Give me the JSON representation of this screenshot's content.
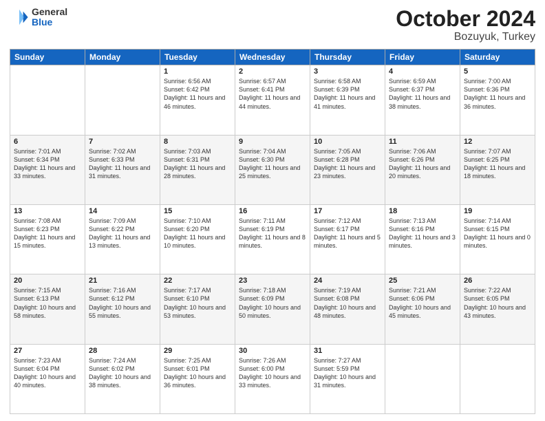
{
  "header": {
    "logo_general": "General",
    "logo_blue": "Blue",
    "title": "October 2024",
    "location": "Bozuyuk, Turkey"
  },
  "weekdays": [
    "Sunday",
    "Monday",
    "Tuesday",
    "Wednesday",
    "Thursday",
    "Friday",
    "Saturday"
  ],
  "weeks": [
    [
      {
        "day": "",
        "info": ""
      },
      {
        "day": "",
        "info": ""
      },
      {
        "day": "1",
        "info": "Sunrise: 6:56 AM\nSunset: 6:42 PM\nDaylight: 11 hours and 46 minutes."
      },
      {
        "day": "2",
        "info": "Sunrise: 6:57 AM\nSunset: 6:41 PM\nDaylight: 11 hours and 44 minutes."
      },
      {
        "day": "3",
        "info": "Sunrise: 6:58 AM\nSunset: 6:39 PM\nDaylight: 11 hours and 41 minutes."
      },
      {
        "day": "4",
        "info": "Sunrise: 6:59 AM\nSunset: 6:37 PM\nDaylight: 11 hours and 38 minutes."
      },
      {
        "day": "5",
        "info": "Sunrise: 7:00 AM\nSunset: 6:36 PM\nDaylight: 11 hours and 36 minutes."
      }
    ],
    [
      {
        "day": "6",
        "info": "Sunrise: 7:01 AM\nSunset: 6:34 PM\nDaylight: 11 hours and 33 minutes."
      },
      {
        "day": "7",
        "info": "Sunrise: 7:02 AM\nSunset: 6:33 PM\nDaylight: 11 hours and 31 minutes."
      },
      {
        "day": "8",
        "info": "Sunrise: 7:03 AM\nSunset: 6:31 PM\nDaylight: 11 hours and 28 minutes."
      },
      {
        "day": "9",
        "info": "Sunrise: 7:04 AM\nSunset: 6:30 PM\nDaylight: 11 hours and 25 minutes."
      },
      {
        "day": "10",
        "info": "Sunrise: 7:05 AM\nSunset: 6:28 PM\nDaylight: 11 hours and 23 minutes."
      },
      {
        "day": "11",
        "info": "Sunrise: 7:06 AM\nSunset: 6:26 PM\nDaylight: 11 hours and 20 minutes."
      },
      {
        "day": "12",
        "info": "Sunrise: 7:07 AM\nSunset: 6:25 PM\nDaylight: 11 hours and 18 minutes."
      }
    ],
    [
      {
        "day": "13",
        "info": "Sunrise: 7:08 AM\nSunset: 6:23 PM\nDaylight: 11 hours and 15 minutes."
      },
      {
        "day": "14",
        "info": "Sunrise: 7:09 AM\nSunset: 6:22 PM\nDaylight: 11 hours and 13 minutes."
      },
      {
        "day": "15",
        "info": "Sunrise: 7:10 AM\nSunset: 6:20 PM\nDaylight: 11 hours and 10 minutes."
      },
      {
        "day": "16",
        "info": "Sunrise: 7:11 AM\nSunset: 6:19 PM\nDaylight: 11 hours and 8 minutes."
      },
      {
        "day": "17",
        "info": "Sunrise: 7:12 AM\nSunset: 6:17 PM\nDaylight: 11 hours and 5 minutes."
      },
      {
        "day": "18",
        "info": "Sunrise: 7:13 AM\nSunset: 6:16 PM\nDaylight: 11 hours and 3 minutes."
      },
      {
        "day": "19",
        "info": "Sunrise: 7:14 AM\nSunset: 6:15 PM\nDaylight: 11 hours and 0 minutes."
      }
    ],
    [
      {
        "day": "20",
        "info": "Sunrise: 7:15 AM\nSunset: 6:13 PM\nDaylight: 10 hours and 58 minutes."
      },
      {
        "day": "21",
        "info": "Sunrise: 7:16 AM\nSunset: 6:12 PM\nDaylight: 10 hours and 55 minutes."
      },
      {
        "day": "22",
        "info": "Sunrise: 7:17 AM\nSunset: 6:10 PM\nDaylight: 10 hours and 53 minutes."
      },
      {
        "day": "23",
        "info": "Sunrise: 7:18 AM\nSunset: 6:09 PM\nDaylight: 10 hours and 50 minutes."
      },
      {
        "day": "24",
        "info": "Sunrise: 7:19 AM\nSunset: 6:08 PM\nDaylight: 10 hours and 48 minutes."
      },
      {
        "day": "25",
        "info": "Sunrise: 7:21 AM\nSunset: 6:06 PM\nDaylight: 10 hours and 45 minutes."
      },
      {
        "day": "26",
        "info": "Sunrise: 7:22 AM\nSunset: 6:05 PM\nDaylight: 10 hours and 43 minutes."
      }
    ],
    [
      {
        "day": "27",
        "info": "Sunrise: 7:23 AM\nSunset: 6:04 PM\nDaylight: 10 hours and 40 minutes."
      },
      {
        "day": "28",
        "info": "Sunrise: 7:24 AM\nSunset: 6:02 PM\nDaylight: 10 hours and 38 minutes."
      },
      {
        "day": "29",
        "info": "Sunrise: 7:25 AM\nSunset: 6:01 PM\nDaylight: 10 hours and 36 minutes."
      },
      {
        "day": "30",
        "info": "Sunrise: 7:26 AM\nSunset: 6:00 PM\nDaylight: 10 hours and 33 minutes."
      },
      {
        "day": "31",
        "info": "Sunrise: 7:27 AM\nSunset: 5:59 PM\nDaylight: 10 hours and 31 minutes."
      },
      {
        "day": "",
        "info": ""
      },
      {
        "day": "",
        "info": ""
      }
    ]
  ]
}
